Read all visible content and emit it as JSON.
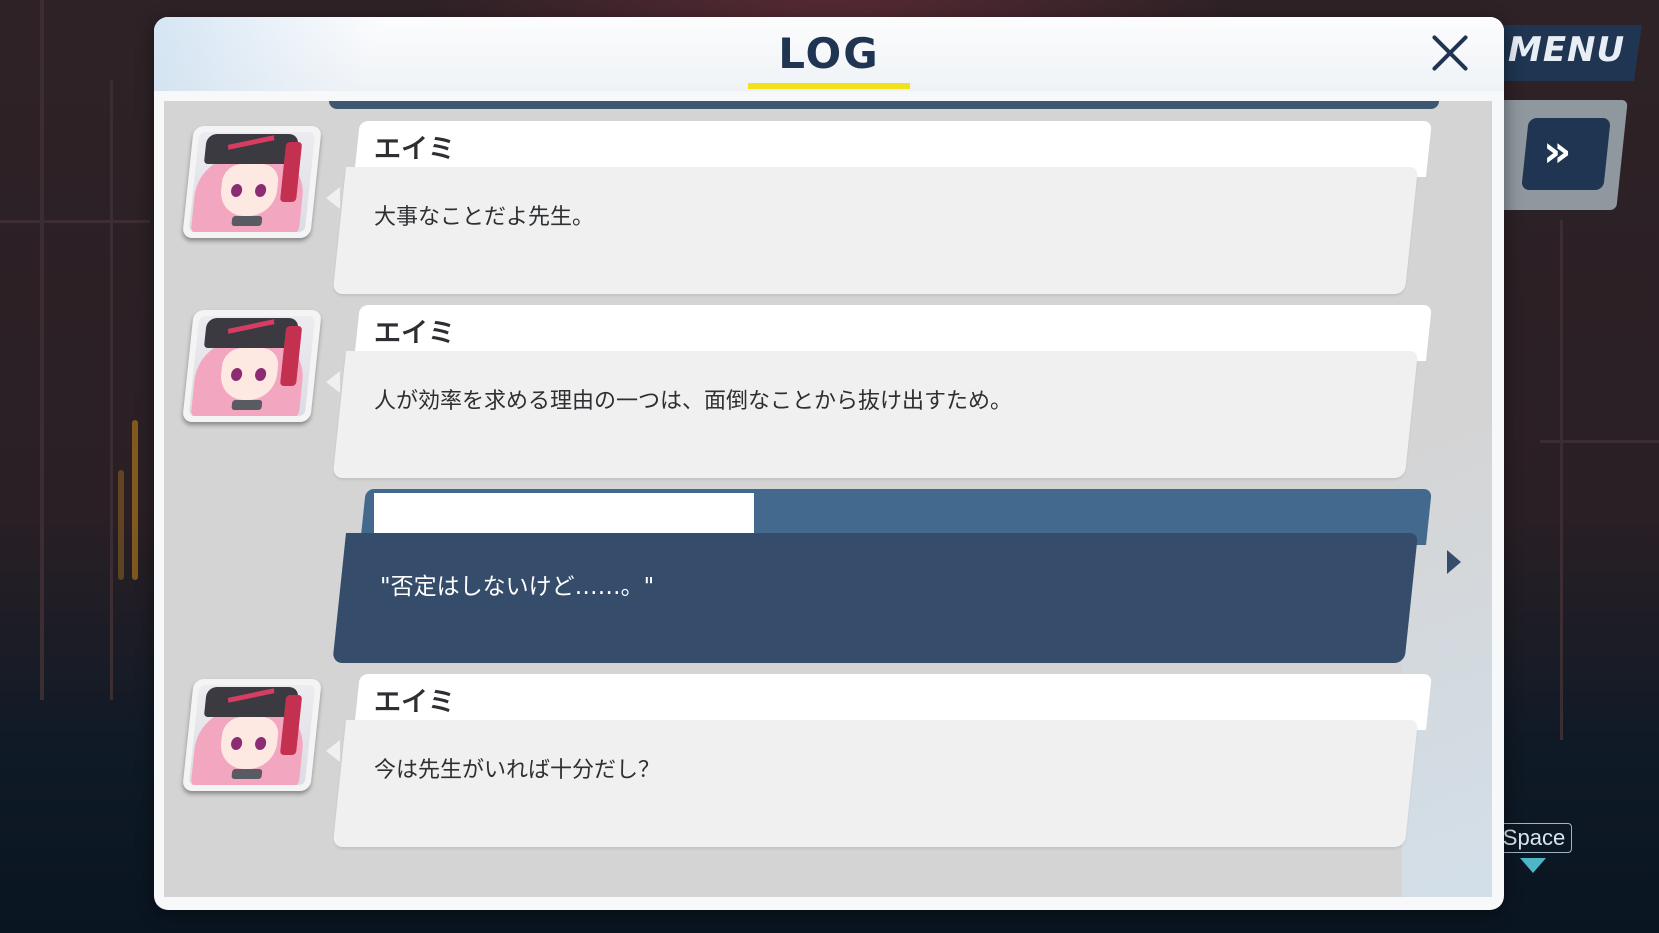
{
  "window": {
    "title": "LOG",
    "close_icon": "close-icon"
  },
  "hud": {
    "menu_label": "MENU",
    "fast_forward_glyph": "»",
    "space_hint": "Space"
  },
  "entries": [
    {
      "type": "character",
      "name": "エイミ",
      "message": "大事なことだよ先生。",
      "avatar": "emi-portrait"
    },
    {
      "type": "character",
      "name": "エイミ",
      "message": "人が効率を求める理由の一つは、面倒なことから抜け出すため。",
      "avatar": "emi-portrait"
    },
    {
      "type": "player",
      "name": "",
      "message": "\"否定はしないけど……。\""
    },
    {
      "type": "character",
      "name": "エイミ",
      "message": "今は先生がいれば十分だし？",
      "avatar": "emi-portrait"
    }
  ],
  "colors": {
    "accent_navy": "#1f3551",
    "underline_yellow": "#f2e21a",
    "player_bubble": "#354d6b",
    "player_header": "#43698f"
  }
}
